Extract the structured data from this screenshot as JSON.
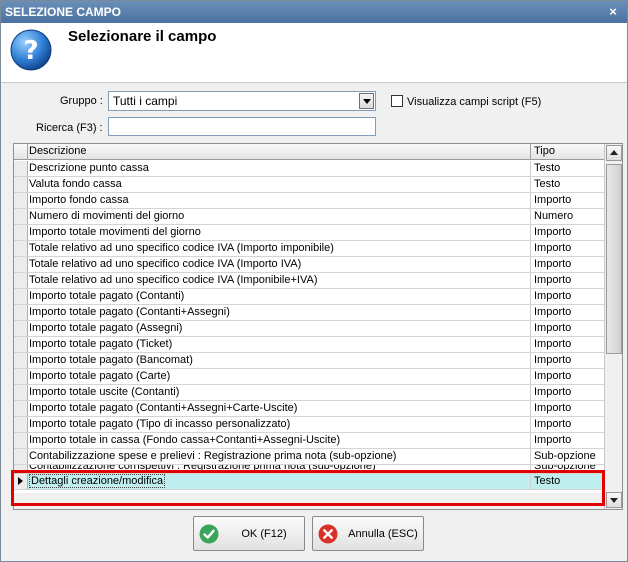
{
  "window": {
    "title": "SELEZIONE CAMPO",
    "close_glyph": "×"
  },
  "header": {
    "title": "Selezionare il campo",
    "icon": "question-icon"
  },
  "filters": {
    "gruppo_label": "Gruppo :",
    "gruppo_value": "Tutti i campi",
    "script_checkbox_label": "Visualizza campi script (F5)",
    "script_checkbox_checked": false,
    "ricerca_label": "Ricerca (F3) :",
    "ricerca_value": ""
  },
  "grid": {
    "columns": [
      "Descrizione",
      "Tipo"
    ],
    "rows": [
      {
        "desc": "Descrizione punto cassa",
        "tipo": "Testo"
      },
      {
        "desc": "Valuta fondo cassa",
        "tipo": "Testo"
      },
      {
        "desc": "Importo fondo cassa",
        "tipo": "Importo"
      },
      {
        "desc": "Numero di movimenti del giorno",
        "tipo": "Numero"
      },
      {
        "desc": "Importo totale movimenti del giorno",
        "tipo": "Importo"
      },
      {
        "desc": "Totale relativo ad uno specifico codice IVA (Importo imponibile)",
        "tipo": "Importo"
      },
      {
        "desc": "Totale relativo ad uno specifico codice IVA (Importo IVA)",
        "tipo": "Importo"
      },
      {
        "desc": "Totale relativo ad uno specifico codice IVA (Imponibile+IVA)",
        "tipo": "Importo"
      },
      {
        "desc": "Importo totale pagato (Contanti)",
        "tipo": "Importo"
      },
      {
        "desc": "Importo totale pagato (Contanti+Assegni)",
        "tipo": "Importo"
      },
      {
        "desc": "Importo totale pagato (Assegni)",
        "tipo": "Importo"
      },
      {
        "desc": "Importo totale pagato (Ticket)",
        "tipo": "Importo"
      },
      {
        "desc": "Importo totale pagato (Bancomat)",
        "tipo": "Importo"
      },
      {
        "desc": "Importo totale pagato (Carte)",
        "tipo": "Importo"
      },
      {
        "desc": "Importo totale uscite (Contanti)",
        "tipo": "Importo"
      },
      {
        "desc": "Importo totale pagato (Contanti+Assegni+Carte-Uscite)",
        "tipo": "Importo"
      },
      {
        "desc": "Importo totale pagato (Tipo di incasso personalizzato)",
        "tipo": "Importo"
      },
      {
        "desc": "Importo totale in cassa (Fondo cassa+Contanti+Assegni-Uscite)",
        "tipo": "Importo"
      },
      {
        "desc": "Contabilizzazione spese e prelievi : Registrazione prima nota (sub-opzione)",
        "tipo": "Sub-opzione"
      },
      {
        "desc": "Contabilizzazione corrispettivi : Registrazione prima nota (sub-opzione)",
        "tipo": "Sub-opzione"
      },
      {
        "desc": "Dettagli creazione/modifica",
        "tipo": "Testo",
        "selected": true
      }
    ]
  },
  "buttons": {
    "ok_label": "OK (F12)",
    "cancel_label": "Annulla (ESC)"
  }
}
